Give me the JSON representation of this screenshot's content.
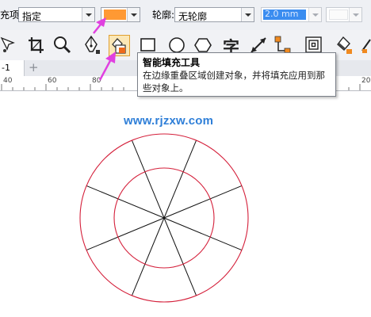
{
  "property_bar": {
    "fill_label": "充项:",
    "fill_mode": "指定",
    "fill_color": "#ff9933",
    "outline_label": "轮廓:",
    "outline_mode": "无轮廓",
    "outline_width": "2.0 mm"
  },
  "toolbar": {
    "tools": [
      "pick-icon",
      "crop-icon",
      "zoom-icon",
      "pen-icon",
      "smart-fill-icon",
      "rectangle-icon",
      "ellipse-icon",
      "polygon-icon",
      "text-icon",
      "dimension-icon",
      "connector-icon",
      "contour-icon",
      "fill-bucket-icon"
    ],
    "text_tool_glyph": "字"
  },
  "document_tab": {
    "label": "-1",
    "add_label": "+"
  },
  "ruler": {
    "ticks": [
      "40",
      "60",
      "80",
      "20"
    ]
  },
  "tooltip": {
    "title": "智能填充工具",
    "description": "在边缘重叠区域创建对象，并将填充应用到那些对象上。"
  },
  "watermark": "www.rjzxw.com",
  "canvas": {
    "shape": "concentric circles divided into 8 segments",
    "stroke_color": "#d41f3a",
    "line_color": "#111111",
    "segments": 8
  },
  "annotations": {
    "arrow_color": "#e040e0"
  }
}
